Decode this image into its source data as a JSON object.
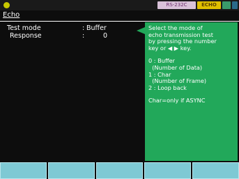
{
  "status": {
    "interface": "RS-232C",
    "mode": "ECHO"
  },
  "title": "Echo",
  "fields": [
    {
      "label": "Test mode",
      "sep": ":",
      "value": "Buffer"
    },
    {
      "label": "Response",
      "sep": ":",
      "value": "0"
    }
  ],
  "help": {
    "intro": [
      "Select the mode of",
      "echo transmission test",
      "by pressing the number",
      "key or ◀ ▶ key."
    ],
    "options": [
      "0 : Buffer",
      "  (Number of Data)",
      "1 : Char",
      "  (Number of Frame)",
      "2 : Loop back"
    ],
    "note": "Char=only if ASYNC"
  },
  "softkeys": [
    "",
    "",
    "",
    "",
    ""
  ]
}
